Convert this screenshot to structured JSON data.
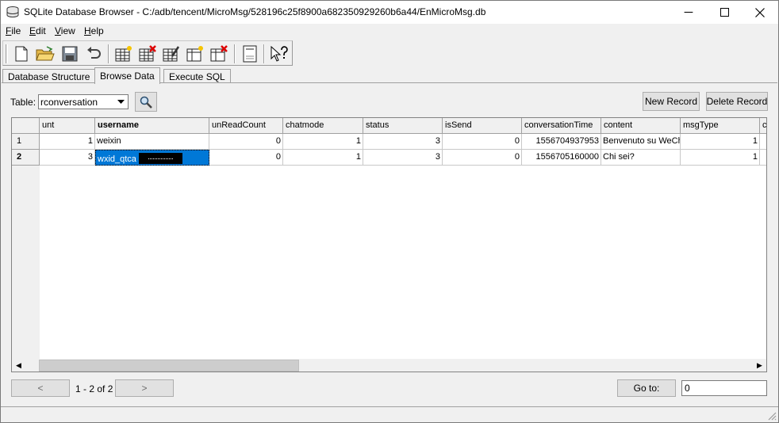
{
  "window": {
    "title": "SQLite Database Browser - C:/adb/tencent/MicroMsg/528196c25f8900a682350929260b6a44/EnMicroMsg.db",
    "minimize_glyph": "─",
    "maximize_glyph": "☐",
    "close_glyph": "✕"
  },
  "menu": [
    {
      "key": "F",
      "rest": "ile"
    },
    {
      "key": "E",
      "rest": "dit"
    },
    {
      "key": "V",
      "rest": "iew"
    },
    {
      "key": "H",
      "rest": "elp"
    }
  ],
  "toolbar_icons": [
    "new-database-icon",
    "open-database-icon",
    "save-icon",
    "undo-icon",
    "create-table-icon",
    "delete-table-icon",
    "modify-table-icon",
    "create-index-icon",
    "delete-index-icon",
    "log-icon",
    "whats-this-icon"
  ],
  "tabs": [
    "Database Structure",
    "Browse Data",
    "Execute SQL"
  ],
  "active_tab": "Browse Data",
  "browse": {
    "table_label": "Table:",
    "table_value": "rconversation",
    "new_record": "New Record",
    "delete_record": "Delete Record"
  },
  "grid": {
    "columns": [
      "unt",
      "username",
      "unReadCount",
      "chatmode",
      "status",
      "isSend",
      "conversationTime",
      "content",
      "msgType",
      "c"
    ],
    "sorted_column": "username",
    "rows": [
      {
        "num": "1",
        "cells": [
          "1",
          "weixin",
          "0",
          "1",
          "3",
          "0",
          "1556704937953",
          "Benvenuto su WeCh",
          "1",
          ""
        ]
      },
      {
        "num": "2",
        "cells": [
          "3",
          "wxid_qtca",
          "0",
          "1",
          "3",
          "0",
          "1556705160000",
          "Chi sei?",
          "1",
          ""
        ]
      }
    ],
    "selected_cell": {
      "row": 2,
      "column": "username"
    },
    "scroll_left_glyph": "◀",
    "scroll_right_glyph": "▶"
  },
  "navigation": {
    "prev": "<",
    "range": "1 - 2 of 2",
    "next": ">",
    "goto_label": "Go to:",
    "goto_value": "0"
  },
  "colors": {
    "selection": "#0078d7",
    "window_bg": "#f0f0f0"
  }
}
